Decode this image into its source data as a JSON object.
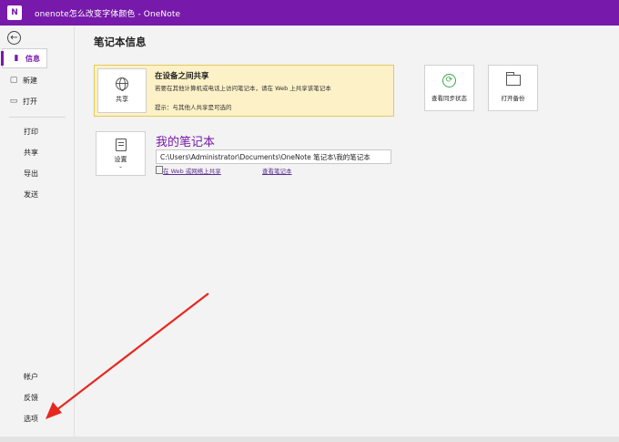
{
  "window": {
    "title": "onenote怎么改变字体颜色 - OneNote",
    "app_icon": "N"
  },
  "sidebar": {
    "back_icon": "←",
    "items": [
      {
        "label": "信息",
        "icon": "info-icon",
        "glyph": "▮"
      },
      {
        "label": "新建",
        "icon": "new-icon",
        "glyph": "▢"
      },
      {
        "label": "打开",
        "icon": "open-icon",
        "glyph": "▭"
      },
      {
        "label": "打印"
      },
      {
        "label": "共享"
      },
      {
        "label": "导出"
      },
      {
        "label": "发送"
      },
      {
        "label": "帐户"
      },
      {
        "label": "反馈"
      },
      {
        "label": "选项"
      }
    ]
  },
  "main": {
    "title": "笔记本信息",
    "share": {
      "button_label": "共享",
      "heading": "在设备之间共享",
      "description": "若要在其他计算机或电话上访问笔记本，请在 Web 上共享该笔记本",
      "tip": "提示：与其他人共享是可选的"
    },
    "sync_button": "查看同步状态",
    "backup_button": "打开备份",
    "settings": {
      "label": "设置",
      "caret": "⌄"
    },
    "notebook": {
      "name": "我的笔记本",
      "path": "C:\\Users\\Administrator\\Documents\\OneNote 笔记本\\我的笔记本",
      "share_link": "在 Web 或网络上共享",
      "view_link": "查看笔记本"
    }
  },
  "colors": {
    "titlebar": "#7719aa",
    "accent": "#7719aa",
    "share_card_bg": "#fdf1c7",
    "arrow": "#e8281e"
  }
}
